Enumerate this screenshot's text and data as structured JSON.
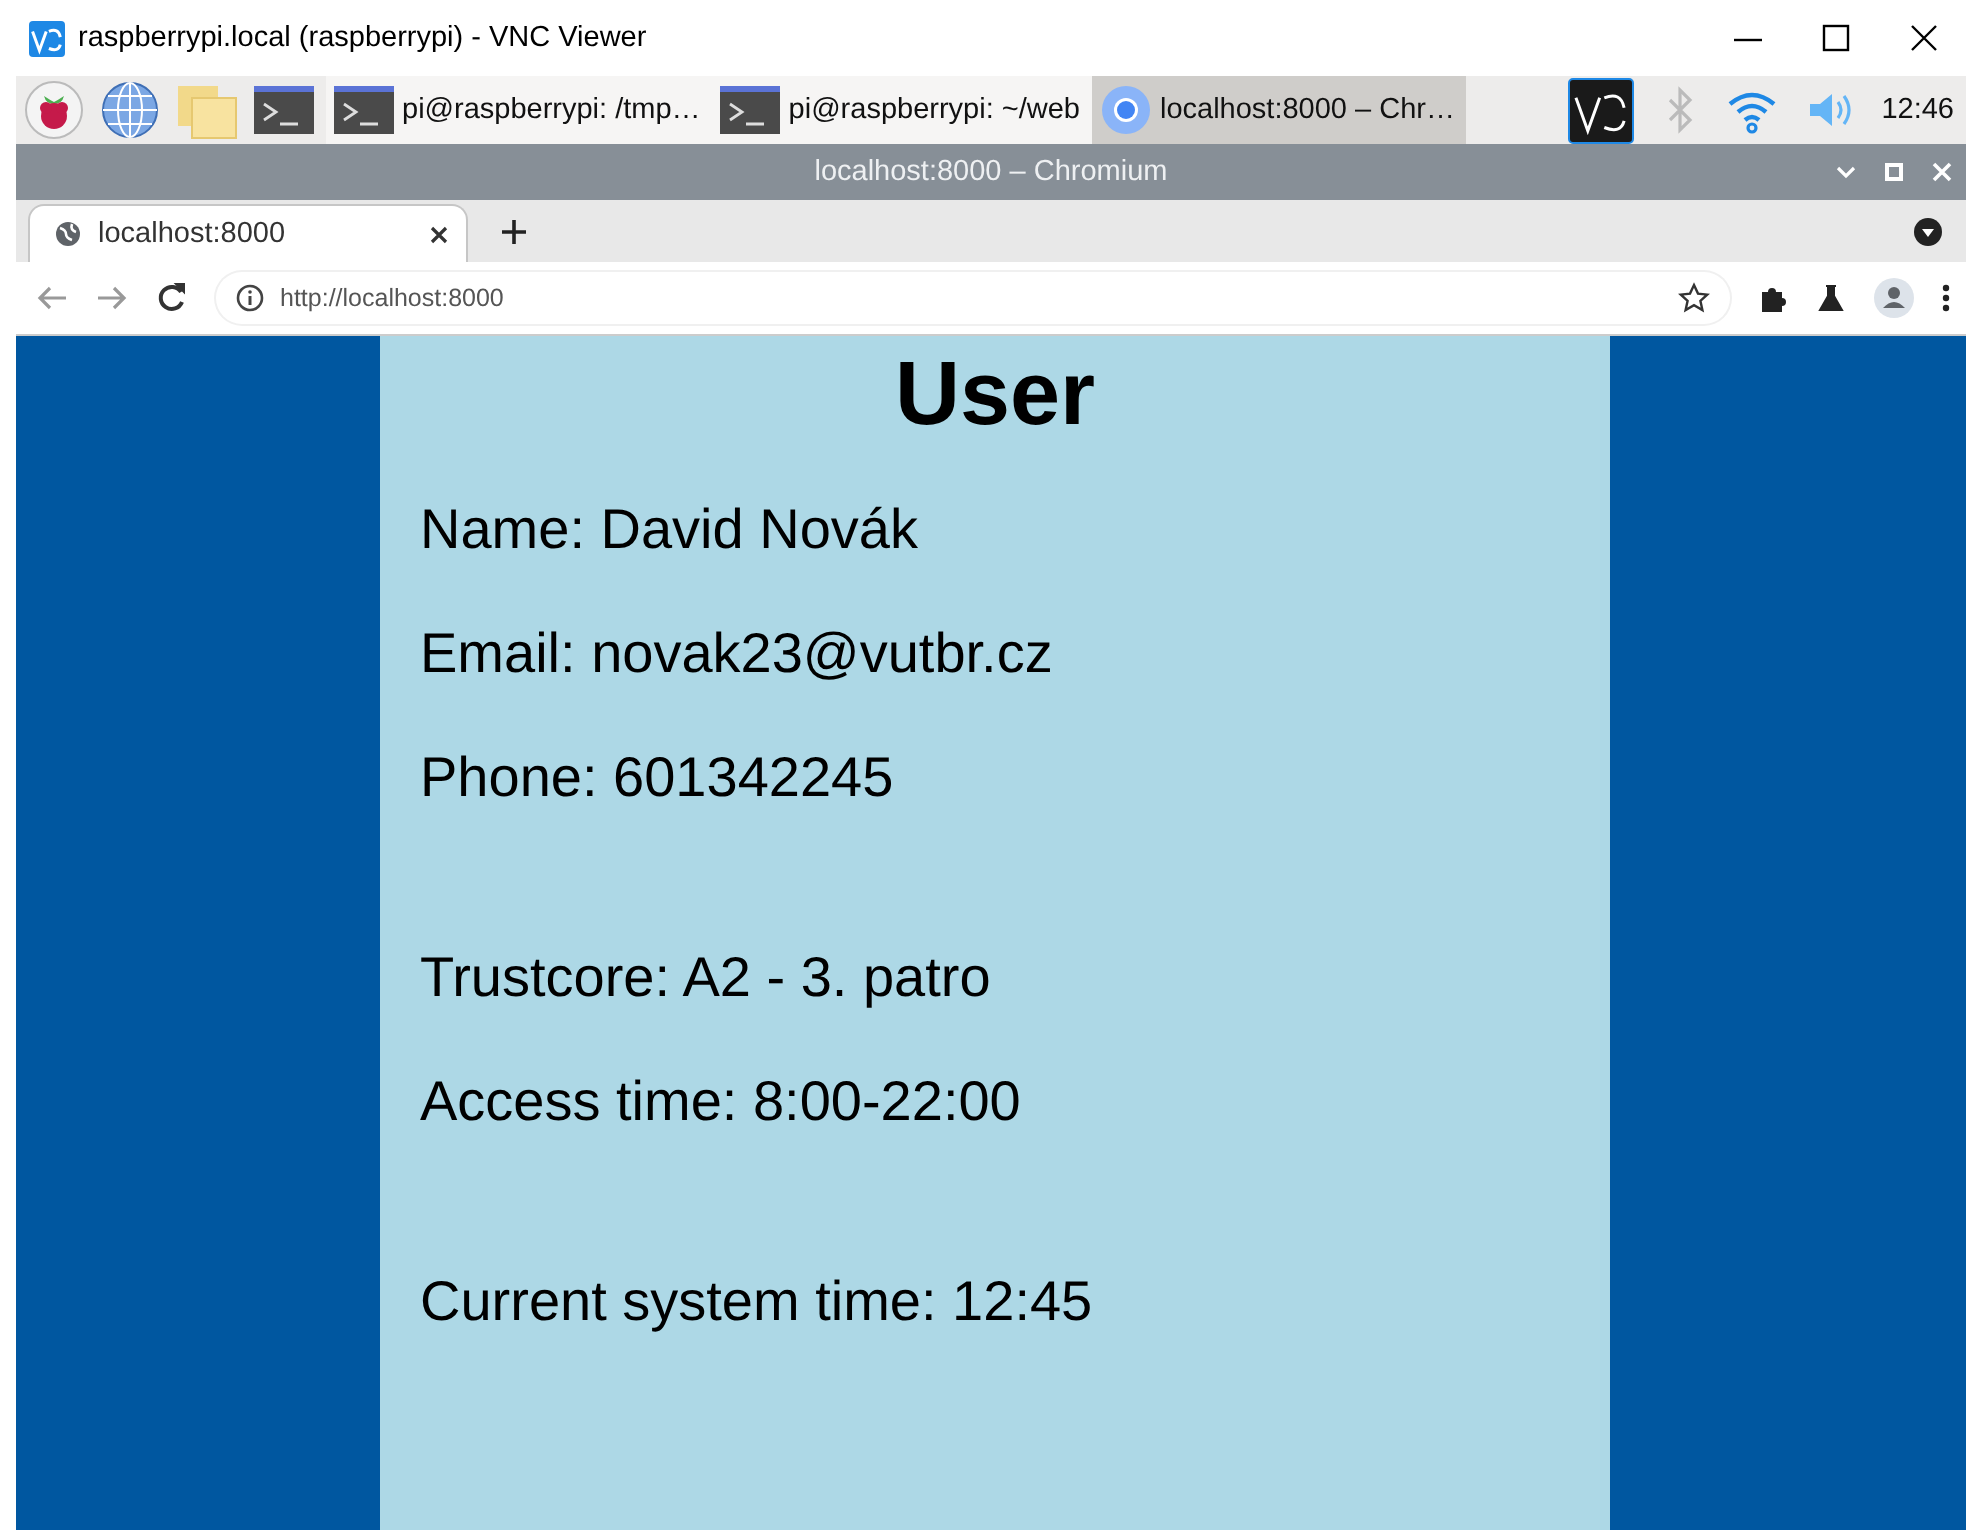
{
  "vnc_window": {
    "title": "raspberrypi.local (raspberrypi) - VNC Viewer"
  },
  "taskbar": {
    "tasks": [
      {
        "kind": "terminal",
        "label": "pi@raspberrypi: /tmp…",
        "selected": false
      },
      {
        "kind": "terminal",
        "label": "pi@raspberrypi: ~/web",
        "selected": false
      },
      {
        "kind": "browser",
        "label": "localhost:8000 – Chr…",
        "selected": true
      }
    ],
    "clock": "12:46"
  },
  "browser": {
    "title": "localhost:8000 – Chromium",
    "tabs": [
      {
        "label": "localhost:8000",
        "selected": true
      }
    ],
    "url": "http://localhost:8000"
  },
  "page": {
    "heading": "User",
    "sections": [
      {
        "lines": [
          "Name: David Novák",
          "Email: novak23@vutbr.cz",
          "Phone: 601342245"
        ]
      },
      {
        "lines": [
          "Trustcore: A2 - 3. patro",
          "Access time: 8:00-22:00"
        ]
      },
      {
        "lines": [
          "Current system time: 12:45"
        ]
      }
    ]
  }
}
